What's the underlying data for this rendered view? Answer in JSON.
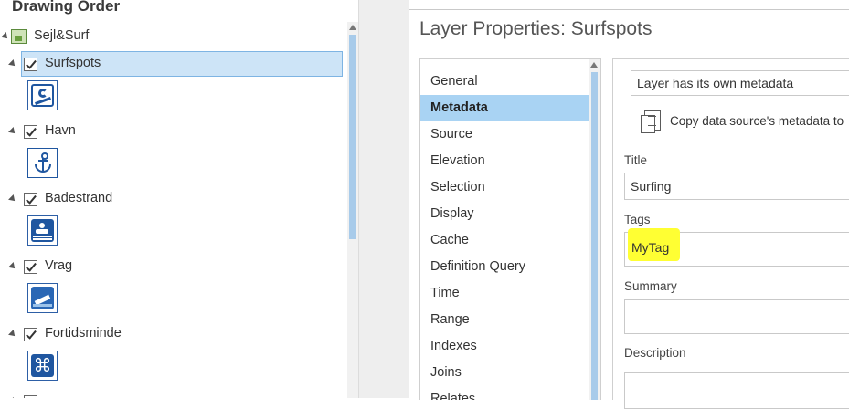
{
  "drawing_order": {
    "title": "Drawing Order",
    "map_name": "Sejl&Surf",
    "layers": [
      {
        "name": "Surfspots",
        "symbol_icon": "surfer-icon"
      },
      {
        "name": "Havn",
        "symbol_icon": "anchor-icon"
      },
      {
        "name": "Badestrand",
        "symbol_icon": "swimmer-icon"
      },
      {
        "name": "Vrag",
        "symbol_icon": "shipwreck-icon"
      },
      {
        "name": "Fortidsminde",
        "symbol_icon": "monument-icon"
      }
    ],
    "selected_layer": "Surfspots"
  },
  "dialog": {
    "title": "Layer Properties: Surfspots",
    "nav_items": [
      "General",
      "Metadata",
      "Source",
      "Elevation",
      "Selection",
      "Display",
      "Cache",
      "Definition Query",
      "Time",
      "Range",
      "Indexes",
      "Joins",
      "Relates"
    ],
    "active_nav": "Metadata",
    "metadata": {
      "mode_value": "Layer has its own metadata",
      "copy_label": "Copy data source's metadata to",
      "title_label": "Title",
      "title_value": "Surfing",
      "tags_label": "Tags",
      "tags_value": "MyTag",
      "summary_label": "Summary",
      "summary_value": "",
      "description_label": "Description",
      "description_value": ""
    }
  },
  "colors": {
    "selection": "#cde4f7",
    "active_nav": "#a9d3f3",
    "symbol_blue": "#1f56a0",
    "highlight": "#ffff33"
  }
}
